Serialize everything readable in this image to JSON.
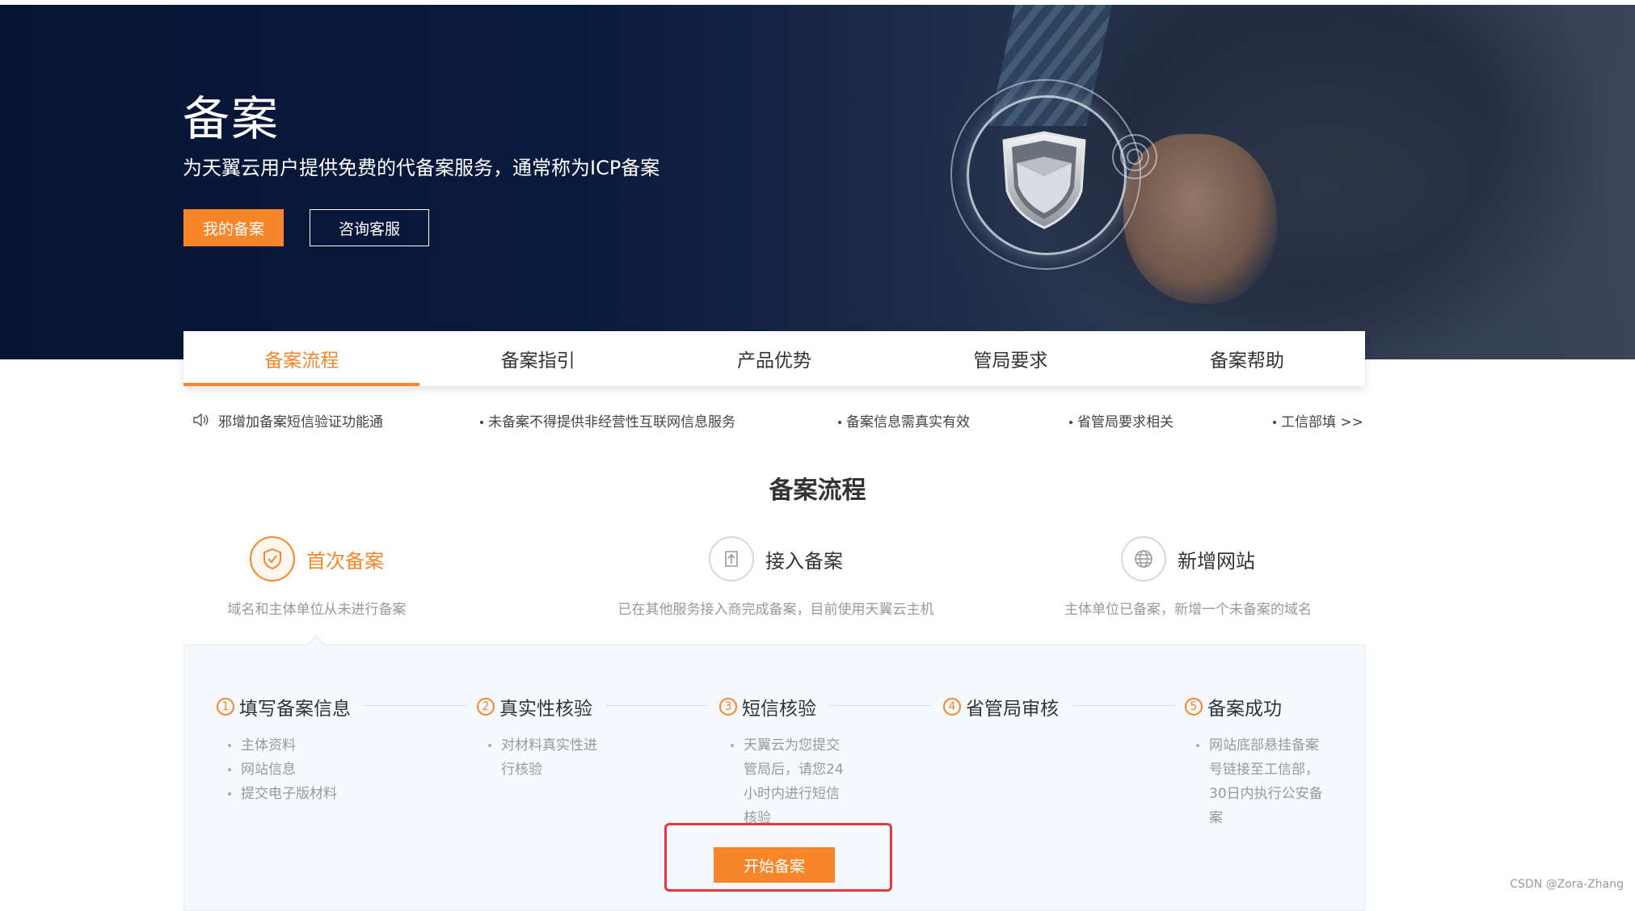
{
  "hero": {
    "title": "备案",
    "subtitle": "为天翼云用户提供免费的代备案服务，通常称为ICP备案",
    "primary_button": "我的备案",
    "secondary_button": "咨询客服"
  },
  "tabs": [
    {
      "label": "备案流程",
      "active": true
    },
    {
      "label": "备案指引",
      "active": false
    },
    {
      "label": "产品优势",
      "active": false
    },
    {
      "label": "管局要求",
      "active": false
    },
    {
      "label": "备案帮助",
      "active": false
    }
  ],
  "notices": [
    "邪增加备案短信验证功能通",
    "未备案不得提供非经营性互联网信息服务",
    "备案信息需真实有效",
    "省管局要求相关",
    "工信部填 >>"
  ],
  "section_title": "备案流程",
  "types": [
    {
      "label": "首次备案",
      "desc": "域名和主体单位从未进行备案",
      "active": true,
      "icon": "shield-check-icon"
    },
    {
      "label": "接入备案",
      "desc": "已在其他服务接入商完成备案，目前使用天翼云主机",
      "active": false,
      "icon": "upload-arrow-icon"
    },
    {
      "label": "新增网站",
      "desc": "主体单位已备案，新增一个未备案的域名",
      "active": false,
      "icon": "globe-icon"
    }
  ],
  "steps": [
    {
      "num": "1",
      "title": "填写备案信息",
      "items": [
        "主体资料",
        "网站信息",
        "提交电子版材料"
      ]
    },
    {
      "num": "2",
      "title": "真实性核验",
      "items": [
        "对材料真实性进行核验"
      ]
    },
    {
      "num": "3",
      "title": "短信核验",
      "items": [
        "天翼云为您提交管局后，请您24小时内进行短信核验"
      ]
    },
    {
      "num": "4",
      "title": "省管局审核",
      "items": []
    },
    {
      "num": "5",
      "title": "备案成功",
      "items": [
        "网站底部悬挂备案号链接至工信部，30日内执行公安备案"
      ]
    }
  ],
  "start_button": "开始备案",
  "watermark": "CSDN @Zora-Zhang",
  "colors": {
    "accent": "#f7862a",
    "hero_bg": "#0a1a3d",
    "highlight": "#e8383d"
  }
}
